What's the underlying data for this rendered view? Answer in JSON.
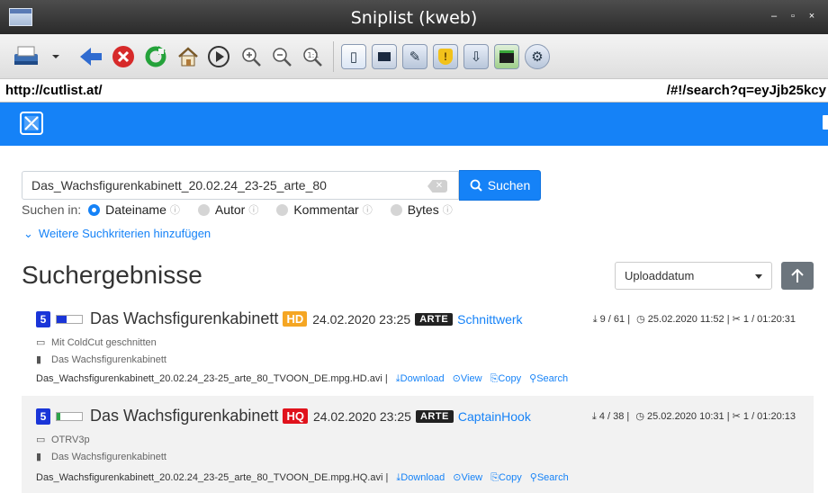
{
  "window": {
    "title": "Sniplist (kweb)"
  },
  "url": {
    "left": "http://cutlist.at/",
    "right": "/#!/search?q=eyJjb25kcy"
  },
  "search": {
    "value": "Das_Wachsfigurenkabinett_20.02.24_23-25_arte_80",
    "button_label": "Suchen",
    "search_in_label": "Suchen in:",
    "options": [
      {
        "label": "Dateiname",
        "selected": true
      },
      {
        "label": "Autor",
        "selected": false
      },
      {
        "label": "Kommentar",
        "selected": false
      },
      {
        "label": "Bytes",
        "selected": false
      }
    ],
    "more_label": "Weitere Suchkriterien hinzufügen"
  },
  "results": {
    "title": "Suchergebnisse",
    "sort_value": "Uploaddatum",
    "items": [
      {
        "rating": "5",
        "rating_fill": 0.4,
        "rating_color": "#1a35d8",
        "title": "Das Wachsfigurenkabinett",
        "quality": "HD",
        "quality_color": "#f5a623",
        "date": "24.02.2020 23:25",
        "station": "ARTE",
        "author": "Schnittwerk",
        "downloads": "9 / 61 |",
        "upload": "25.02.2020 11:52",
        "cuts": "1 / 01:20:31",
        "comment": "Mit ColdCut geschnitten",
        "movie": "Das Wachsfigurenkabinett",
        "filename": "Das_Wachsfigurenkabinett_20.02.24_23-25_arte_80_TVOON_DE.mpg.HD.avi",
        "links": {
          "download": "Download",
          "view": "View",
          "copy": "Copy",
          "search": "Search"
        }
      },
      {
        "rating": "5",
        "rating_fill": 0.15,
        "rating_color": "#2ea34a",
        "title": "Das Wachsfigurenkabinett",
        "quality": "HQ",
        "quality_color": "#e0121c",
        "date": "24.02.2020 23:25",
        "station": "ARTE",
        "author": "CaptainHook",
        "downloads": "4 / 38 |",
        "upload": "25.02.2020 10:31",
        "cuts": "1 / 01:20:13",
        "comment": "OTRV3p",
        "movie": "Das Wachsfigurenkabinett",
        "filename": "Das_Wachsfigurenkabinett_20.02.24_23-25_arte_80_TVOON_DE.mpg.HQ.avi",
        "links": {
          "download": "Download",
          "view": "View",
          "copy": "Copy",
          "search": "Search"
        }
      }
    ]
  }
}
